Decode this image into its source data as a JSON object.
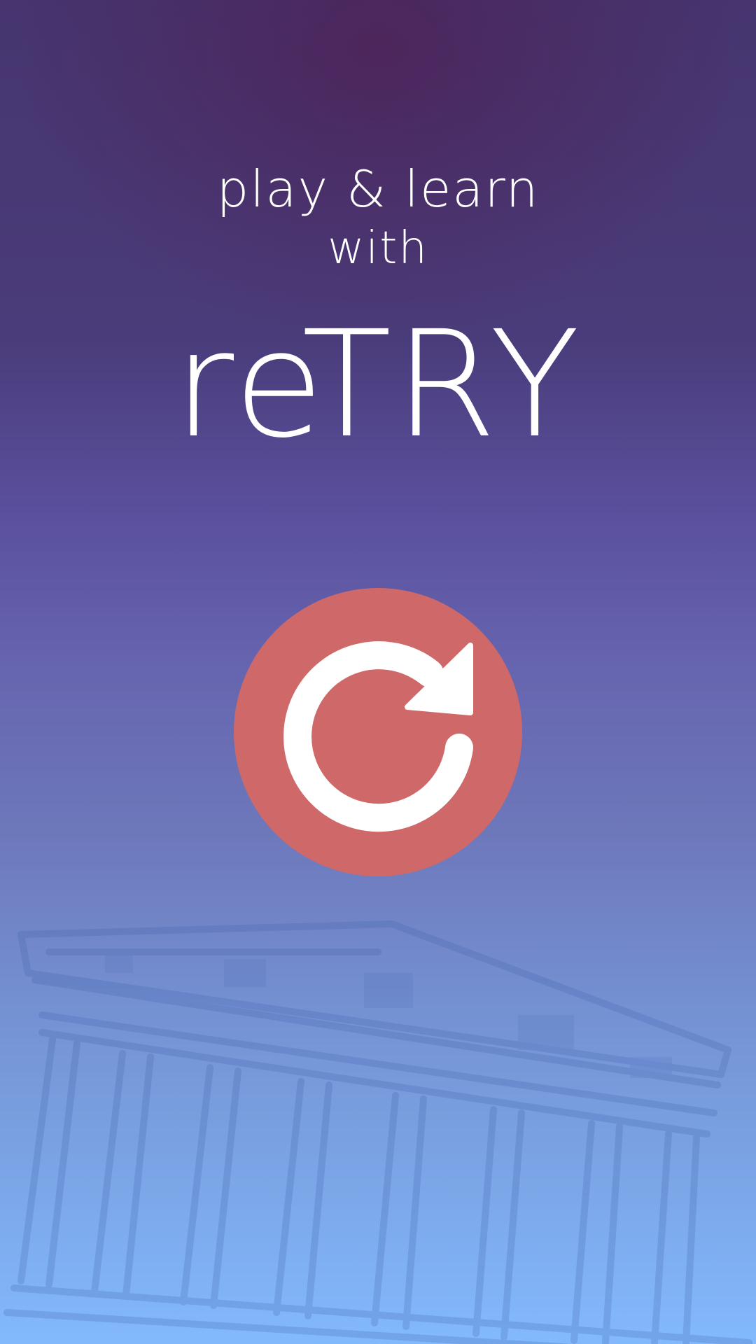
{
  "screen": {
    "tagline_line1": "play & learn",
    "tagline_line2": "with",
    "app_title": "reTRY"
  },
  "retry_button": {
    "icon": "refresh-icon",
    "background_color": "#cf6868",
    "icon_color": "#ffffff"
  },
  "background": {
    "top_color": "#46356f",
    "bottom_color": "#82b9fd",
    "illustration": "temple-columns-sketch"
  }
}
